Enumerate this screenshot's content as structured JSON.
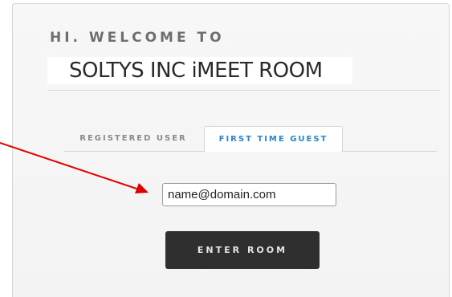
{
  "greeting": "HI. WELCOME TO",
  "room_title": "SOLTYS INC iMEET ROOM",
  "tabs": [
    {
      "label": "REGISTERED USER",
      "active": false
    },
    {
      "label": "FIRST TIME GUEST",
      "active": true
    }
  ],
  "email_field": {
    "value": "name@domain.com",
    "placeholder": ""
  },
  "enter_button": {
    "label": "ENTER ROOM"
  },
  "colors": {
    "accent": "#2b86c5",
    "button_bg": "#2f2f2f",
    "annotation": "#e00000"
  }
}
